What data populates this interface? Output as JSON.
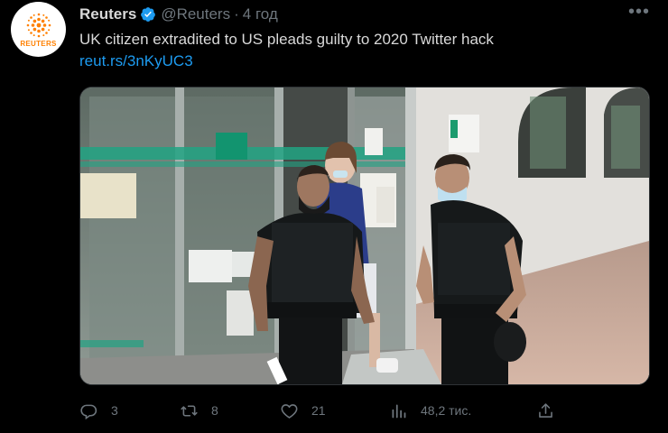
{
  "tweet": {
    "author_name": "Reuters",
    "handle": "@Reuters",
    "separator": "·",
    "time": "4 год",
    "text": "UK citizen extradited to US pleads guilty to 2020 Twitter hack",
    "link": "reut.rs/3nKyUC3",
    "avatar_text": "REUTERS",
    "more_label": "•••"
  },
  "actions": {
    "replies": "3",
    "retweets": "8",
    "likes": "21",
    "views": "48,2 тис."
  },
  "colors": {
    "background": "#000000",
    "text": "#d9d9d9",
    "muted": "#6e767d",
    "link": "#1d9bf0",
    "verified": "#1d9bf0",
    "reuters_orange": "#ff8000"
  },
  "icons": {
    "reply": "reply-icon",
    "retweet": "retweet-icon",
    "like": "heart-icon",
    "views": "views-icon",
    "share": "share-icon",
    "verified": "verified-badge-icon",
    "more": "more-icon"
  }
}
